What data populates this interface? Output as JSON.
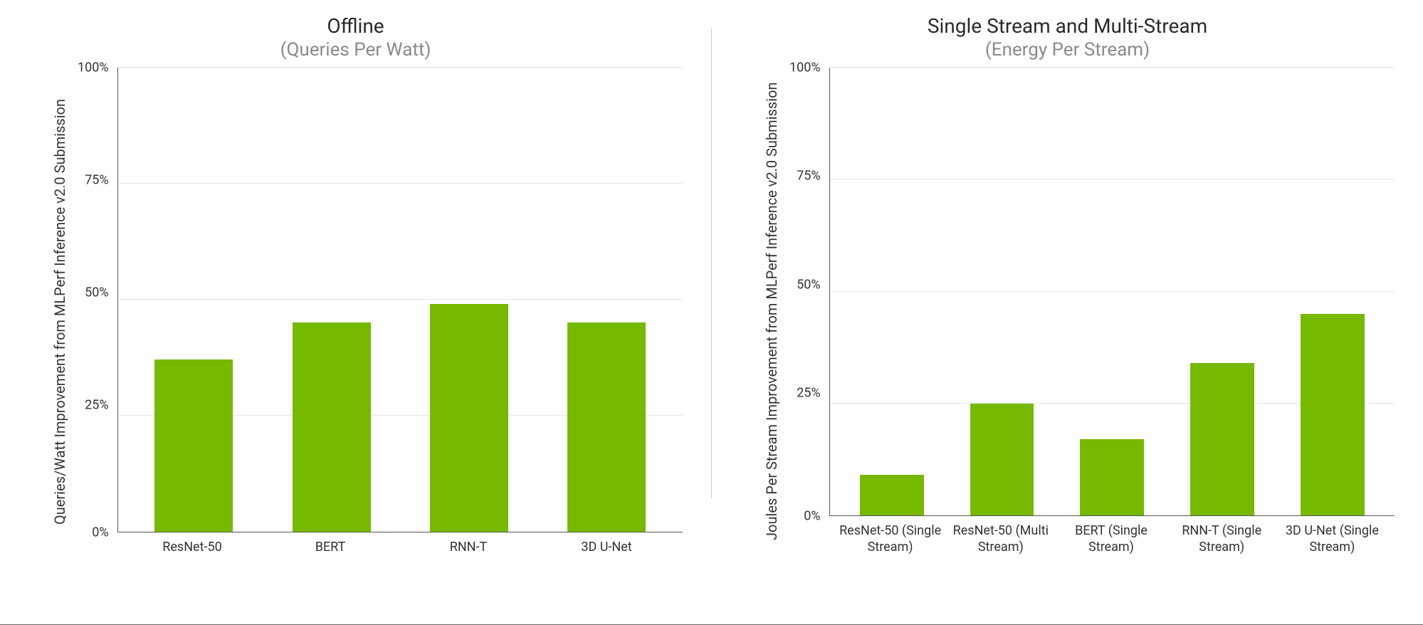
{
  "chart_data": [
    {
      "type": "bar",
      "title": "Offline",
      "subtitle": "(Queries Per Watt)",
      "ylabel": "Queries/Watt Improvement from MLPerf\nInference v2.0 Submission",
      "xlabel": "",
      "ylim": [
        0,
        100
      ],
      "yticks": [
        0,
        25,
        50,
        75,
        100
      ],
      "ytick_labels": [
        "0%",
        "25%",
        "50%",
        "75%",
        "100%"
      ],
      "categories": [
        "ResNet-50",
        "BERT",
        "RNN-T",
        "3D U-Net"
      ],
      "values": [
        37,
        45,
        49,
        45
      ],
      "bar_color": "#76b900"
    },
    {
      "type": "bar",
      "title": "Single Stream and Multi-Stream",
      "subtitle": "(Energy Per Stream)",
      "ylabel": "Joules  Per Stream Improvement from MLPerf\nInference v2.0 Submission",
      "xlabel": "",
      "ylim": [
        0,
        100
      ],
      "yticks": [
        0,
        25,
        50,
        75,
        100
      ],
      "ytick_labels": [
        "0%",
        "25%",
        "50%",
        "75%",
        "100%"
      ],
      "categories": [
        "ResNet-50 (Single Stream)",
        "ResNet-50 (Multi Stream)",
        "BERT (Single Stream)",
        "RNN-T (Single Stream)",
        "3D U-Net (Single Stream)"
      ],
      "values": [
        9,
        25,
        17,
        34,
        45
      ],
      "bar_color": "#76b900"
    }
  ]
}
